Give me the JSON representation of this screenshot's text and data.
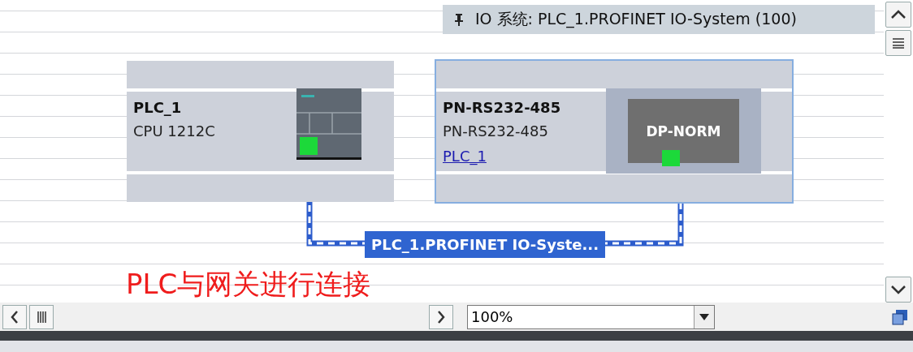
{
  "header": {
    "title": "IO 系统: PLC_1.PROFINET IO-System (100)"
  },
  "devices": [
    {
      "kind": "plc",
      "name": "PLC_1",
      "type": "CPU 1212C",
      "selected": false
    },
    {
      "kind": "gateway",
      "name": "PN-RS232-485",
      "type": "PN-RS232-485",
      "controller": "PLC_1",
      "module_label": "DP-NORM",
      "selected": true
    }
  ],
  "network": {
    "label": "PLC_1.PROFINET IO-Syste..."
  },
  "annotation": "PLC与网关进行连接",
  "zoom": {
    "value": "100%"
  }
}
